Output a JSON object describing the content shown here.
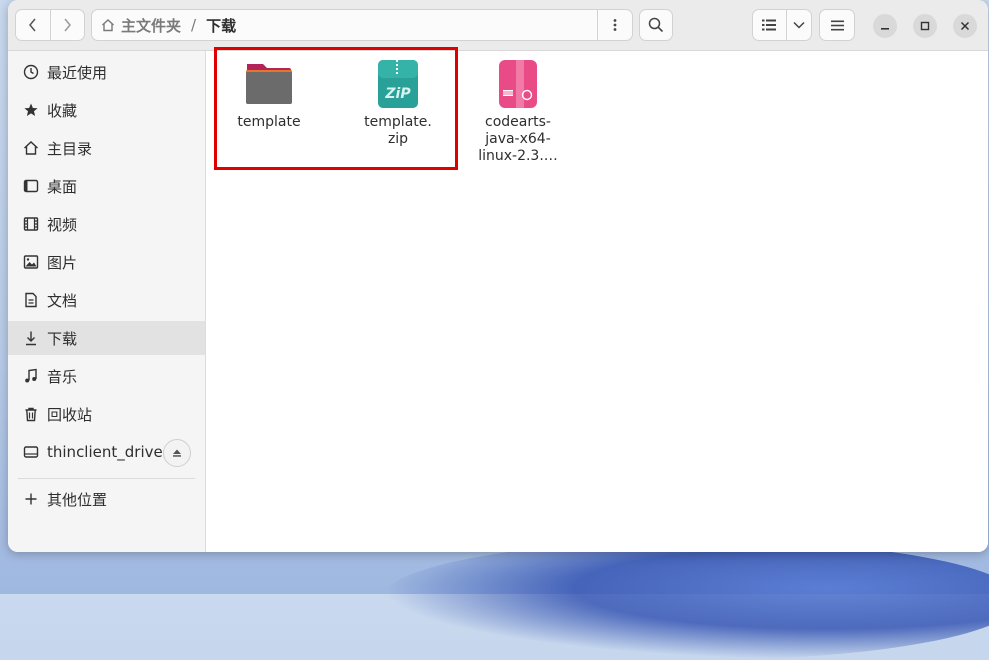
{
  "header": {
    "path_home": "主文件夹",
    "path_separator": "/",
    "path_current": "下载"
  },
  "sidebar": {
    "items": [
      {
        "label": "最近使用",
        "icon": "clock-icon"
      },
      {
        "label": "收藏",
        "icon": "star-icon"
      },
      {
        "label": "主目录",
        "icon": "home-icon"
      },
      {
        "label": "桌面",
        "icon": "desktop-icon"
      },
      {
        "label": "视频",
        "icon": "video-icon"
      },
      {
        "label": "图片",
        "icon": "image-icon"
      },
      {
        "label": "文档",
        "icon": "document-icon"
      },
      {
        "label": "下载",
        "icon": "download-icon"
      },
      {
        "label": "音乐",
        "icon": "music-icon"
      },
      {
        "label": "回收站",
        "icon": "trash-icon"
      },
      {
        "label": "thinclient_drives",
        "icon": "drive-icon"
      },
      {
        "label": "其他位置",
        "icon": "plus-icon"
      }
    ],
    "active": "下载"
  },
  "files": [
    {
      "name": "template",
      "type": "folder"
    },
    {
      "name_line1": "template.",
      "name_line2": "zip",
      "type": "zip"
    },
    {
      "name_line1": "codearts-",
      "name_line2": "java-x64-",
      "name_line3": "linux-2.3.…",
      "type": "deb-package"
    }
  ],
  "colors": {
    "highlight": "#e00000",
    "folder": "#6b6b6b",
    "folder_tab": "#b3245a",
    "zip": "#2aa198",
    "package": "#e94b86"
  }
}
